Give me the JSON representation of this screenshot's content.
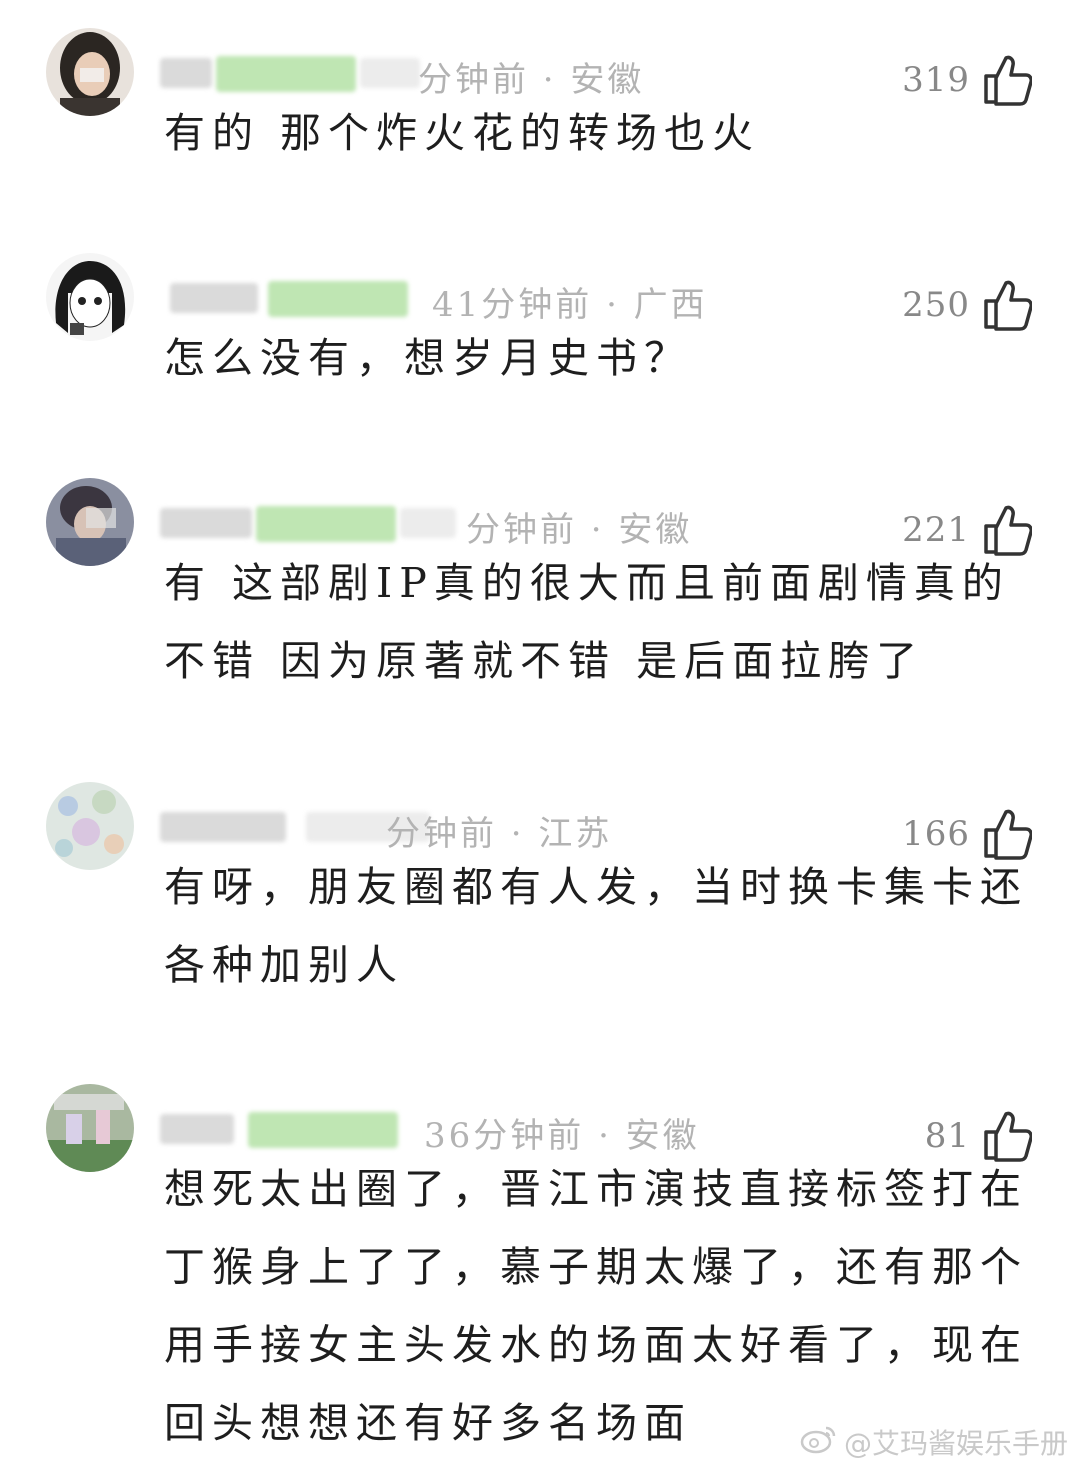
{
  "comments": [
    {
      "meta": "分钟前 · 安徽",
      "likes": "319",
      "text": "有的 那个炸火花的转场也火"
    },
    {
      "meta": "41分钟前 · 广西",
      "likes": "250",
      "text": "怎么没有，想岁月史书？"
    },
    {
      "meta": "分钟前 · 安徽",
      "likes": "221",
      "text": "有  这部剧IP真的很大而且前面剧情真的不错 因为原著就不错 是后面拉胯了"
    },
    {
      "meta": "分钟前 · 江苏",
      "likes": "166",
      "text": "有呀，朋友圈都有人发，当时换卡集卡还各种加别人"
    },
    {
      "meta": "36分钟前 · 安徽",
      "likes": "81",
      "text": "想死太出圈了，晋江市演技直接标签打在丁猴身上了了，慕子期太爆了，还有那个用手接女主头发水的场面太好看了，现在回头想想还有好多名场面"
    }
  ],
  "watermark": "@艾玛酱娱乐手册",
  "icons": {
    "like": "thumbs-up-icon",
    "watermark_logo": "weibo-logo-icon"
  },
  "colors": {
    "meta_text": "#b3b3b3",
    "like_count": "#888888",
    "comment_text": "#1e1e1e",
    "name_badge_green": "#bfe6b3"
  }
}
